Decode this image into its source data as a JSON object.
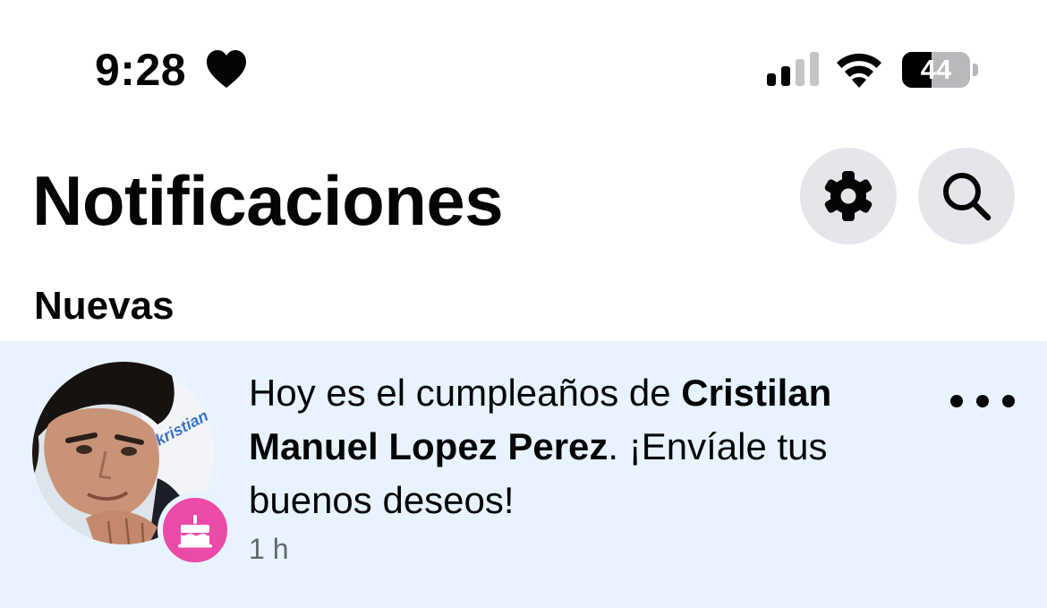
{
  "status_bar": {
    "time": "9:28",
    "focus_icon": "heart-icon",
    "signal_icon": "cellular-signal-icon",
    "signal_bars_active": 2,
    "signal_bars_total": 4,
    "wifi_icon": "wifi-icon",
    "battery_level_percent": 44,
    "battery_label": "44"
  },
  "header": {
    "title": "Notificaciones",
    "settings_icon": "gear-icon",
    "search_icon": "search-icon"
  },
  "sections": [
    {
      "title": "Nuevas",
      "notifications": [
        {
          "text_prefix": "Hoy es el cumpleaños de ",
          "name": "Cristilan Manuel Lopez Perez",
          "text_suffix": ". ¡Envíale tus buenos deseos!",
          "time": "1 h",
          "avatar_caption": "kristian",
          "badge_icon": "birthday-cake-icon",
          "more_icon": "more-options-icon",
          "unread": true
        }
      ]
    }
  ],
  "colors": {
    "unread_background": "#e7f3ff",
    "icon_button_background": "#e4e6eb",
    "birthday_badge": "#ec4aa8",
    "secondary_text": "#65676b",
    "primary_text": "#050505"
  }
}
